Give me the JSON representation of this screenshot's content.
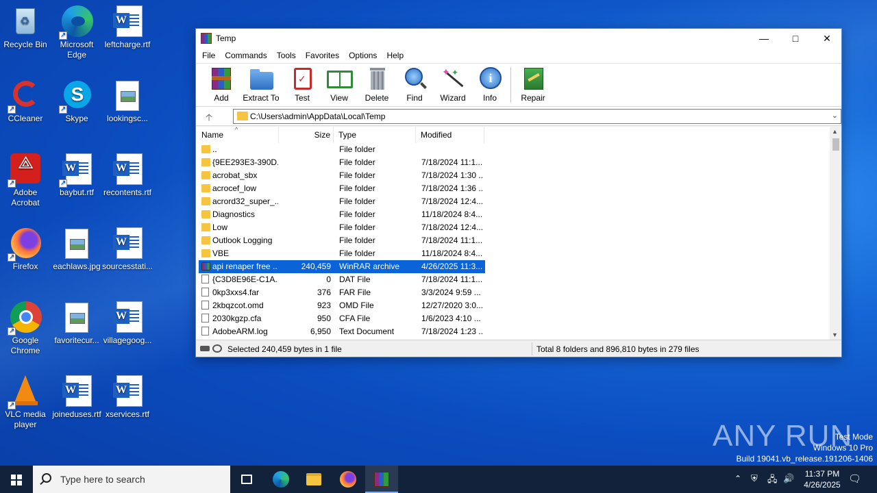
{
  "desktop": {
    "icons": [
      {
        "label": "Recycle Bin"
      },
      {
        "label": "Microsoft Edge"
      },
      {
        "label": "leftcharge.rtf"
      },
      {
        "label": "CCleaner"
      },
      {
        "label": "Skype"
      },
      {
        "label": "lookingsc..."
      },
      {
        "label": "Adobe Acrobat"
      },
      {
        "label": "baybut.rtf"
      },
      {
        "label": "recontents.rtf"
      },
      {
        "label": "Firefox"
      },
      {
        "label": "eachlaws.jpg"
      },
      {
        "label": "sourcesstati..."
      },
      {
        "label": "Google Chrome"
      },
      {
        "label": "favoritecur..."
      },
      {
        "label": "villagegoog..."
      },
      {
        "label": "VLC media player"
      },
      {
        "label": "joineduses.rtf"
      },
      {
        "label": "xservices.rtf"
      }
    ]
  },
  "window": {
    "title": "Temp",
    "menu": [
      "File",
      "Commands",
      "Tools",
      "Favorites",
      "Options",
      "Help"
    ],
    "toolbar": [
      "Add",
      "Extract To",
      "Test",
      "View",
      "Delete",
      "Find",
      "Wizard",
      "Info",
      "Repair"
    ],
    "address": "C:\\Users\\admin\\AppData\\Local\\Temp",
    "columns": [
      "Name",
      "Size",
      "Type",
      "Modified"
    ],
    "rows": [
      {
        "name": "..",
        "size": "",
        "type": "File folder",
        "modified": "",
        "kind": "folder"
      },
      {
        "name": "{9EE293E3-390D...",
        "size": "",
        "type": "File folder",
        "modified": "7/18/2024 11:1...",
        "kind": "folder"
      },
      {
        "name": "acrobat_sbx",
        "size": "",
        "type": "File folder",
        "modified": "7/18/2024 1:30 ...",
        "kind": "folder"
      },
      {
        "name": "acrocef_low",
        "size": "",
        "type": "File folder",
        "modified": "7/18/2024 1:36 ...",
        "kind": "folder"
      },
      {
        "name": "acrord32_super_...",
        "size": "",
        "type": "File folder",
        "modified": "7/18/2024 12:4...",
        "kind": "folder"
      },
      {
        "name": "Diagnostics",
        "size": "",
        "type": "File folder",
        "modified": "11/18/2024 8:4...",
        "kind": "folder"
      },
      {
        "name": "Low",
        "size": "",
        "type": "File folder",
        "modified": "7/18/2024 12:4...",
        "kind": "folder"
      },
      {
        "name": "Outlook Logging",
        "size": "",
        "type": "File folder",
        "modified": "7/18/2024 11:1...",
        "kind": "folder"
      },
      {
        "name": "VBE",
        "size": "",
        "type": "File folder",
        "modified": "11/18/2024 8:4...",
        "kind": "folder"
      },
      {
        "name": "api renaper free ...",
        "size": "240,459",
        "type": "WinRAR archive",
        "modified": "4/26/2025 11:3...",
        "kind": "rar",
        "selected": true
      },
      {
        "name": "{C3D8E96E-C1A...",
        "size": "0",
        "type": "DAT File",
        "modified": "7/18/2024 11:1...",
        "kind": "file"
      },
      {
        "name": "0kp3xxs4.far",
        "size": "376",
        "type": "FAR File",
        "modified": "3/3/2024 9:59 ...",
        "kind": "file"
      },
      {
        "name": "2kbqzcot.omd",
        "size": "923",
        "type": "OMD File",
        "modified": "12/27/2020 3:0...",
        "kind": "file"
      },
      {
        "name": "2030kgzp.cfa",
        "size": "950",
        "type": "CFA File",
        "modified": "1/6/2023 4:10 ...",
        "kind": "file"
      },
      {
        "name": "AdobeARM.log",
        "size": "6,950",
        "type": "Text Document",
        "modified": "7/18/2024 1:23 ...",
        "kind": "log"
      }
    ],
    "status_left": "Selected 240,459 bytes in 1 file",
    "status_right": "Total 8 folders and 896,810 bytes in 279 files"
  },
  "taskbar": {
    "search_placeholder": "Type here to search",
    "time": "11:37 PM",
    "date": "4/26/2025"
  },
  "watermark": {
    "brand": "ANY RUN",
    "line1": "Test Mode",
    "line2": "Windows 10 Pro",
    "line3": "Build 19041.vb_release.191206-1406"
  }
}
